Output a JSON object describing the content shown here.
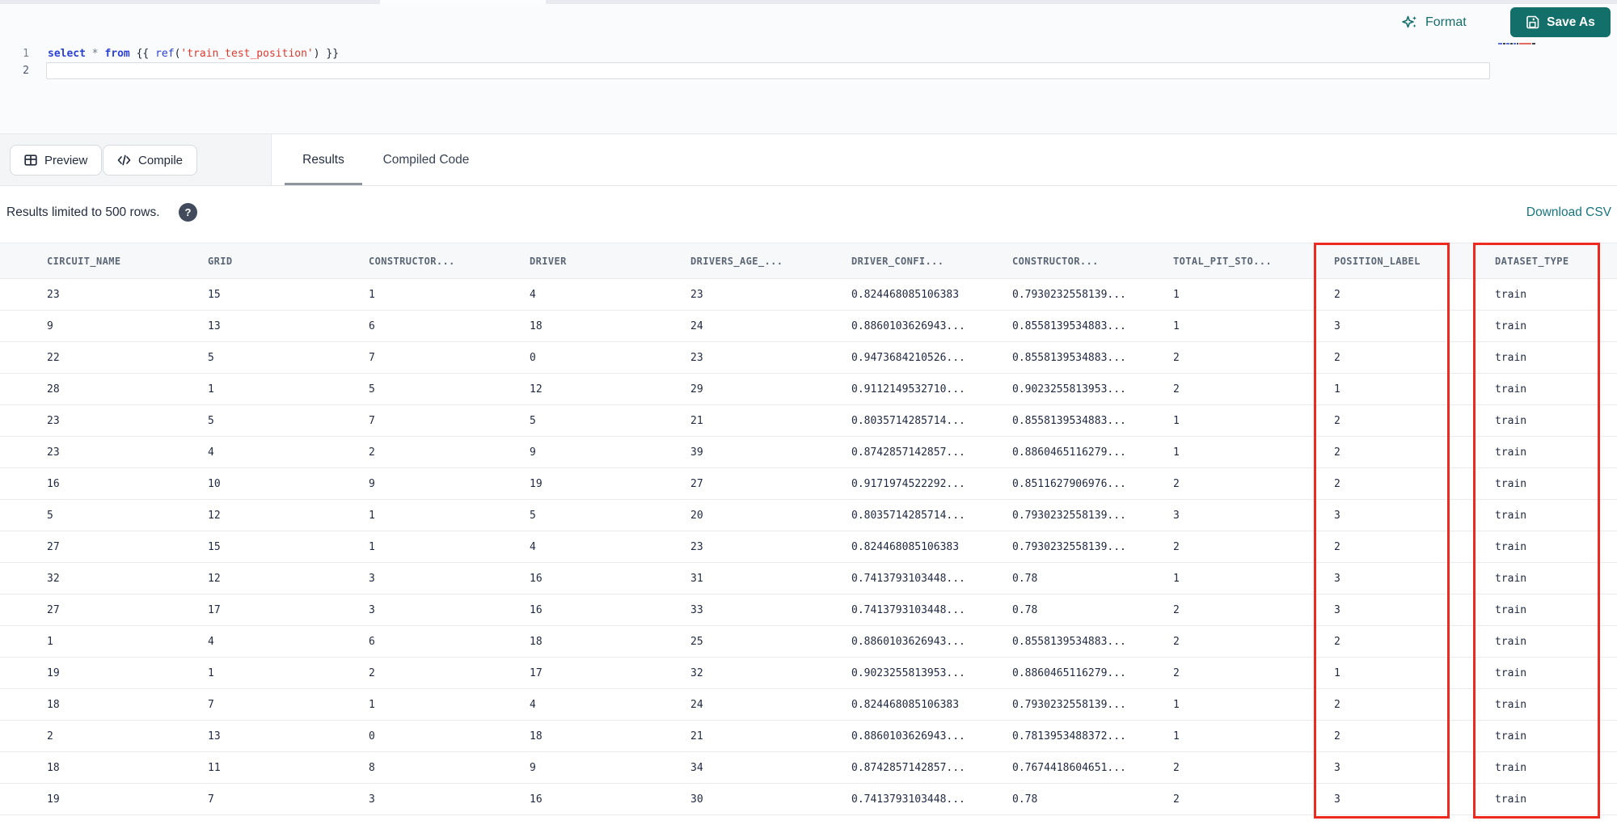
{
  "top_actions": {
    "format_label": "Format",
    "save_as_label": "Save As"
  },
  "editor": {
    "line_numbers": [
      "1",
      "2"
    ],
    "tokens": [
      {
        "t": "select",
        "c": "kw"
      },
      {
        "t": " ",
        "c": "pl"
      },
      {
        "t": "*",
        "c": "op"
      },
      {
        "t": " ",
        "c": "pl"
      },
      {
        "t": "from",
        "c": "kw"
      },
      {
        "t": " ",
        "c": "pl"
      },
      {
        "t": "{{",
        "c": "pl"
      },
      {
        "t": " ",
        "c": "pl"
      },
      {
        "t": "ref",
        "c": "fn"
      },
      {
        "t": "(",
        "c": "pl"
      },
      {
        "t": "'train_test_position'",
        "c": "str"
      },
      {
        "t": ")",
        "c": "pl"
      },
      {
        "t": " ",
        "c": "pl"
      },
      {
        "t": "}}",
        "c": "pl"
      }
    ]
  },
  "toolbar": {
    "preview_label": "Preview",
    "compile_label": "Compile",
    "tabs": [
      {
        "label": "Results",
        "active": true
      },
      {
        "label": "Compiled Code",
        "active": false
      }
    ]
  },
  "results_bar": {
    "limit_note": "Results limited to 500 rows.",
    "help_icon": "question-mark-circle",
    "download_label": "Download CSV"
  },
  "table": {
    "headers": [
      "CIRCUIT_NAME",
      "GRID",
      "CONSTRUCTOR...",
      "DRIVER",
      "DRIVERS_AGE_...",
      "DRIVER_CONFI...",
      "CONSTRUCTOR...",
      "TOTAL_PIT_STO...",
      "POSITION_LABEL",
      "DATASET_TYPE"
    ],
    "rows": [
      [
        "23",
        "15",
        "1",
        "4",
        "23",
        "0.824468085106383",
        "0.7930232558139...",
        "1",
        "2",
        "train"
      ],
      [
        "9",
        "13",
        "6",
        "18",
        "24",
        "0.8860103626943...",
        "0.8558139534883...",
        "1",
        "3",
        "train"
      ],
      [
        "22",
        "5",
        "7",
        "0",
        "23",
        "0.9473684210526...",
        "0.8558139534883...",
        "2",
        "2",
        "train"
      ],
      [
        "28",
        "1",
        "5",
        "12",
        "29",
        "0.9112149532710...",
        "0.9023255813953...",
        "2",
        "1",
        "train"
      ],
      [
        "23",
        "5",
        "7",
        "5",
        "21",
        "0.8035714285714...",
        "0.8558139534883...",
        "1",
        "2",
        "train"
      ],
      [
        "23",
        "4",
        "2",
        "9",
        "39",
        "0.8742857142857...",
        "0.8860465116279...",
        "1",
        "2",
        "train"
      ],
      [
        "16",
        "10",
        "9",
        "19",
        "27",
        "0.9171974522292...",
        "0.8511627906976...",
        "2",
        "2",
        "train"
      ],
      [
        "5",
        "12",
        "1",
        "5",
        "20",
        "0.8035714285714...",
        "0.7930232558139...",
        "3",
        "3",
        "train"
      ],
      [
        "27",
        "15",
        "1",
        "4",
        "23",
        "0.824468085106383",
        "0.7930232558139...",
        "2",
        "2",
        "train"
      ],
      [
        "32",
        "12",
        "3",
        "16",
        "31",
        "0.7413793103448...",
        "0.78",
        "1",
        "3",
        "train"
      ],
      [
        "27",
        "17",
        "3",
        "16",
        "33",
        "0.7413793103448...",
        "0.78",
        "2",
        "3",
        "train"
      ],
      [
        "1",
        "4",
        "6",
        "18",
        "25",
        "0.8860103626943...",
        "0.8558139534883...",
        "2",
        "2",
        "train"
      ],
      [
        "19",
        "1",
        "2",
        "17",
        "32",
        "0.9023255813953...",
        "0.8860465116279...",
        "2",
        "1",
        "train"
      ],
      [
        "18",
        "7",
        "1",
        "4",
        "24",
        "0.824468085106383",
        "0.7930232558139...",
        "1",
        "2",
        "train"
      ],
      [
        "2",
        "13",
        "0",
        "18",
        "21",
        "0.8860103626943...",
        "0.7813953488372...",
        "1",
        "2",
        "train"
      ],
      [
        "18",
        "11",
        "8",
        "9",
        "34",
        "0.8742857142857...",
        "0.7674418604651...",
        "2",
        "3",
        "train"
      ],
      [
        "19",
        "7",
        "3",
        "16",
        "30",
        "0.7413793103448...",
        "0.78",
        "2",
        "3",
        "train"
      ]
    ],
    "annotations": [
      {
        "type": "red-box",
        "column": "POSITION_LABEL"
      },
      {
        "type": "red-box",
        "column": "DATASET_TYPE"
      }
    ]
  },
  "colors": {
    "accent_teal": "#136f6a",
    "link_teal": "#16757e",
    "annotation_red": "#ee291f",
    "keyword_blue": "#2b41d6",
    "string_red": "#dd3a2e"
  }
}
